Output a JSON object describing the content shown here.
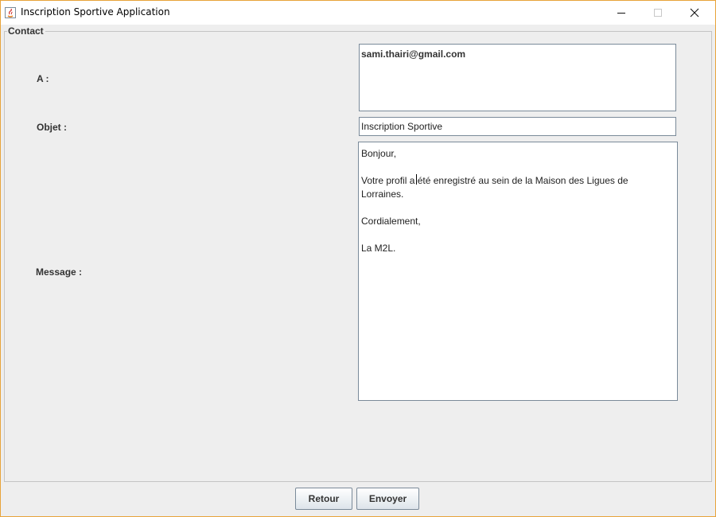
{
  "window": {
    "title": "Inscription Sportive Application",
    "controls": {
      "minimize": "minimize-icon",
      "maximize": "maximize-icon",
      "close": "close-icon"
    }
  },
  "form": {
    "group_title": "Contact",
    "to_label": "A :",
    "to_value": "sami.thairi@gmail.com",
    "subject_label": "Objet :",
    "subject_value": "Inscription Sportive",
    "message_label": "Message :",
    "message_lines": [
      "Bonjour,",
      "",
      "Votre profil a été enregistré au sein de la Maison des Ligues de",
      "Lorraines.",
      "",
      "Cordialement,",
      "",
      "La M2L."
    ]
  },
  "buttons": {
    "back": "Retour",
    "send": "Envoyer"
  },
  "colors": {
    "window_border": "#e8a33a",
    "background": "#eeeeee",
    "field_border": "#7a8a99"
  }
}
